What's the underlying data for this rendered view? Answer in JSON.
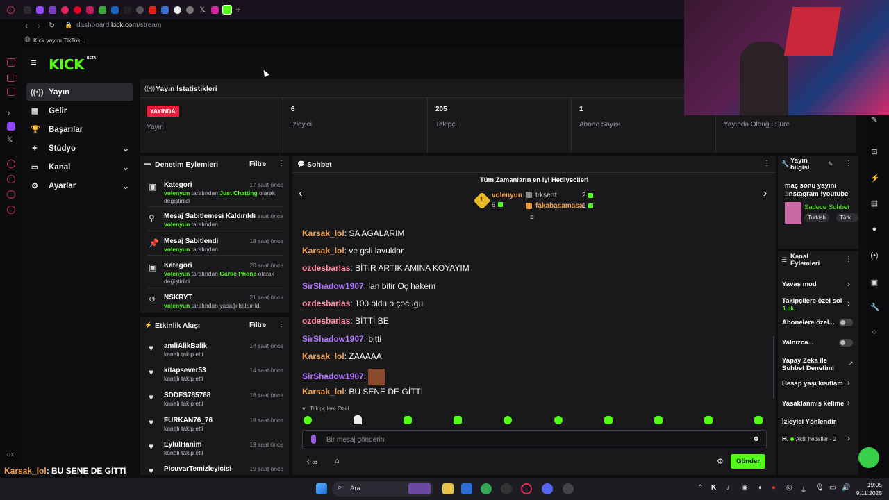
{
  "browser": {
    "url_prefix": "dashboard.",
    "url_domain": "kick.com",
    "url_path": "/stream",
    "bookmark": "Kick yayını TikTok..."
  },
  "nav": {
    "logo": "KICK",
    "logo_badge": "BETA",
    "items": [
      {
        "label": "Yayın",
        "icon": "stream-icon"
      },
      {
        "label": "Gelir",
        "icon": "revenue-icon"
      },
      {
        "label": "Başarılar",
        "icon": "trophy-icon"
      },
      {
        "label": "Stüdyo",
        "icon": "studio-icon"
      },
      {
        "label": "Kanal",
        "icon": "channel-icon"
      },
      {
        "label": "Ayarlar",
        "icon": "gear-icon"
      }
    ]
  },
  "stats": {
    "title": "Yayın İstatistikleri",
    "live_badge": "YAYINDA",
    "cells": [
      {
        "value": "",
        "label": "Yayın"
      },
      {
        "value": "6",
        "label": "İzleyici"
      },
      {
        "value": "205",
        "label": "Takipçi"
      },
      {
        "value": "1",
        "label": "Abone Sayısı"
      },
      {
        "value": "",
        "label": "Yayında Olduğu Süre"
      }
    ]
  },
  "moderation": {
    "title": "Denetim Eylemleri",
    "filter": "Filtre",
    "items": [
      {
        "title": "Kategori",
        "time": "17 saat önce",
        "user": "volenyun",
        "pre": " tarafından ",
        "hl": "Just Chatting",
        "post": " olarak değiştirildi"
      },
      {
        "title": "Mesaj Sabitlemesi Kaldırıldı",
        "time": "18 saat önce",
        "user": "volenyun",
        "pre": " tarafından",
        "hl": "",
        "post": ""
      },
      {
        "title": "Mesaj Sabitlendi",
        "time": "18 saat önce",
        "user": "volenyun",
        "pre": " tarafından",
        "hl": "",
        "post": ""
      },
      {
        "title": "Kategori",
        "time": "20 saat önce",
        "user": "volenyun",
        "pre": " tarafından ",
        "hl": "Gartic Phone",
        "post": " olarak değiştirildi"
      },
      {
        "title": "NSKRYT",
        "time": "21 saat önce",
        "user": "volenyun",
        "pre": " tarafından yasağı kaldırıldı",
        "hl": "",
        "post": ""
      }
    ]
  },
  "activity": {
    "title": "Etkinlik Akışı",
    "filter": "Filtre",
    "items": [
      {
        "user": "amliAlikBalik",
        "time": "14 saat önce",
        "desc": "kanalı takip etti"
      },
      {
        "user": "kitapsever53",
        "time": "14 saat önce",
        "desc": "kanalı takip etti"
      },
      {
        "user": "SDDFS785768",
        "time": "16 saat önce",
        "desc": "kanalı takip etti"
      },
      {
        "user": "FURKAN76_76",
        "time": "18 saat önce",
        "desc": "kanalı takip etti"
      },
      {
        "user": "EylulHanim",
        "time": "19 saat önce",
        "desc": "kanalı takip etti"
      },
      {
        "user": "PisuvarTemizleyicisi",
        "time": "19 saat önce",
        "desc": ""
      }
    ]
  },
  "chat": {
    "title": "Sohbet",
    "gifters_title": "Tüm Zamanların en iyi Hediyecileri",
    "gifters": [
      {
        "rank": "1",
        "name": "volenyun",
        "count": "6"
      },
      {
        "name": "trksertt",
        "count": "2"
      },
      {
        "name": "fakabasamasa",
        "count": "1"
      }
    ],
    "messages": [
      {
        "user": "Karsak_lol",
        "color": "u-or",
        "text": "SA AGALARIM"
      },
      {
        "user": "Karsak_lol",
        "color": "u-or",
        "text": "ve gsli lavuklar"
      },
      {
        "user": "ozdesbarlas",
        "color": "u-pk",
        "text": "BİTİR ARTIK AMINA KOYAYIM"
      },
      {
        "user": "SirShadow1907",
        "color": "u-pu",
        "text": "lan bitir Oç hakem"
      },
      {
        "user": "ozdesbarlas",
        "color": "u-pk",
        "text": "100 oldu o çocuğu"
      },
      {
        "user": "ozdesbarlas",
        "color": "u-pk",
        "text": "BİTTİ BE"
      },
      {
        "user": "SirShadow1907",
        "color": "u-pu",
        "text": "bitti"
      },
      {
        "user": "Karsak_lol",
        "color": "u-or",
        "text": "ZAAAAA"
      },
      {
        "user": "SirShadow1907",
        "color": "u-pu",
        "text": ""
      },
      {
        "user": "Karsak_lol",
        "color": "u-or",
        "text": "BU SENE DE GİTTİ"
      }
    ],
    "followers_only": "Takipçilere Özel",
    "input_placeholder": "Bir mesaj gönderin",
    "send": "Gönder"
  },
  "stream_info": {
    "title": "Yayın bilgisi",
    "stream_title": "maç sonu yayını !instagram !youtube",
    "category": "Sadece Sohbet",
    "tags": [
      "Turkish",
      "Türk"
    ]
  },
  "channel_actions": {
    "title": "Kanal Eylemleri",
    "items": [
      {
        "label": "Yavaş mod",
        "sub": "",
        "control": "chevron"
      },
      {
        "label": "Takipçilere özel sol",
        "sub": "1 dk.",
        "control": "chevron"
      },
      {
        "label": "Abonelere özel...",
        "sub": "",
        "control": "toggle"
      },
      {
        "label": "Yalnızca...",
        "sub": "",
        "control": "toggle"
      },
      {
        "label": "Yapay Zeka ile Sohbet Denetimi",
        "sub": "",
        "control": "external"
      },
      {
        "label": "Hesap yaşı kısıtlam",
        "sub": "",
        "control": "chevron"
      },
      {
        "label": "Yasaklanmış kelime",
        "sub": "",
        "control": "chevron"
      },
      {
        "label": "İzleyici Yönlendir",
        "sub": "",
        "control": "none"
      },
      {
        "label": "H.",
        "sub": "Aktif hedefler - 2",
        "control": "chevron"
      }
    ]
  },
  "overlay": {
    "user": "Karsak_lol",
    "text": ": BU SENE DE GİTTİ"
  },
  "taskbar": {
    "search": "Ara",
    "time": "19:05",
    "date": "9.11.2025"
  },
  "colors": {
    "kick_green": "#53fc18",
    "live_red": "#e91e3c",
    "panel": "#19191c"
  }
}
